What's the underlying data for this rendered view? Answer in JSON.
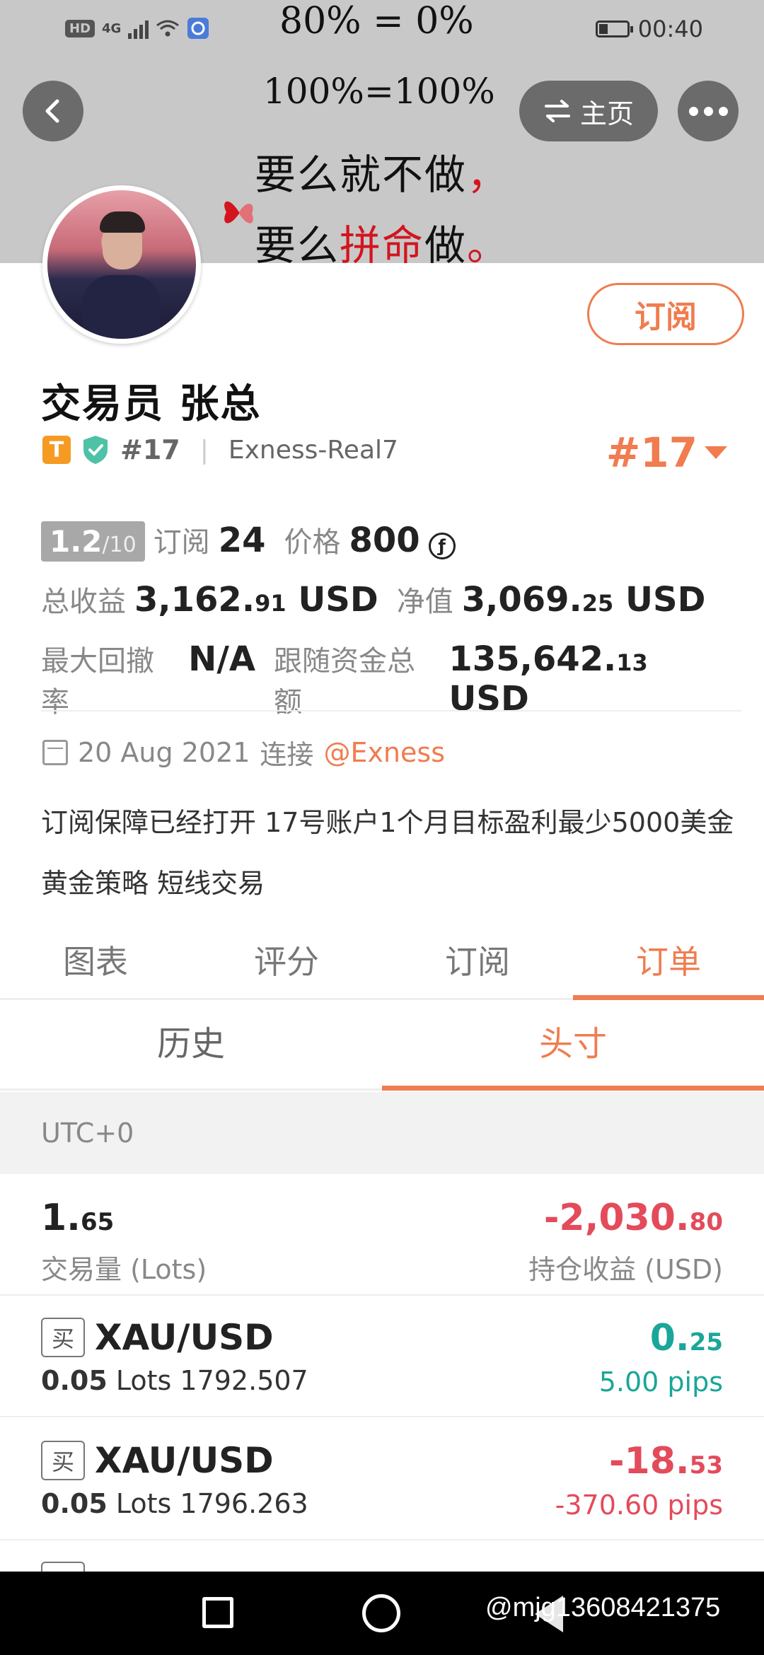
{
  "status_bar": {
    "network_chip": "HD",
    "network_type": "4G",
    "time": "00:40"
  },
  "banner": {
    "line1": "80% = 0%",
    "line2": "100%=100%",
    "line3_a": "要么就不做",
    "line3_b": "，",
    "line4_a": "要么",
    "line4_b": "拼命",
    "line4_c": "做",
    "line4_d": "。",
    "home_label": "主页"
  },
  "profile": {
    "subscribe_label": "订阅",
    "name": "交易员  张总",
    "badge_letter": "T",
    "rank_small": "#17",
    "account": "Exness-Real7",
    "rank_big": "#17"
  },
  "stats": {
    "rating_main": "1.2",
    "rating_denom": "/10",
    "subscribers_label": "订阅",
    "subscribers_value": "24",
    "price_label": "价格",
    "price_value": "800",
    "price_icon": "ƒ",
    "total_profit_label": "总收益",
    "total_profit_int": "3,162.",
    "total_profit_dec": "91",
    "total_profit_unit": "USD",
    "equity_label": "净值",
    "equity_int": "3,069.",
    "equity_dec": "25",
    "equity_unit": "USD",
    "max_drawdown_label": "最大回撤率",
    "max_drawdown_value": "N/A",
    "follow_funds_label": "跟随资金总额",
    "follow_funds_int": "135,642.",
    "follow_funds_dec": "13",
    "follow_funds_unit": "USD"
  },
  "since": {
    "date": "20 Aug 2021",
    "connected_label": "连接",
    "broker": "@Exness"
  },
  "description": "订阅保障已经打开 17号账户1个月目标盈利最少5000美金 黄金策略 短线交易",
  "tabs": [
    {
      "label": "图表"
    },
    {
      "label": "评分"
    },
    {
      "label": "订阅"
    },
    {
      "label": "订单"
    }
  ],
  "subtabs": [
    {
      "label": "历史"
    },
    {
      "label": "头寸"
    }
  ],
  "timezone": "UTC+0",
  "summary": {
    "volume_int": "1.",
    "volume_dec": "65",
    "volume_label": "交易量 (Lots)",
    "floating_int": "-2,030.",
    "floating_dec": "80",
    "floating_label": "持仓收益 (USD)"
  },
  "positions": [
    {
      "side": "买",
      "symbol": "XAU/USD",
      "lots": "0.05",
      "lots_unit": "Lots",
      "open_price": "1792.507",
      "pnl_int": "0.",
      "pnl_dec": "25",
      "pips": "5.00 pips",
      "color": "#1aa698"
    },
    {
      "side": "买",
      "symbol": "XAU/USD",
      "lots": "0.05",
      "lots_unit": "Lots",
      "open_price": "1796.263",
      "pnl_int": "-18.",
      "pnl_dec": "53",
      "pips": "-370.60 pips",
      "color": "#e34b5b"
    }
  ],
  "watermark": "@mjg13608421375",
  "colors": {
    "accent": "#f07c4f",
    "negative": "#e34b5b",
    "positive": "#1aa698"
  }
}
